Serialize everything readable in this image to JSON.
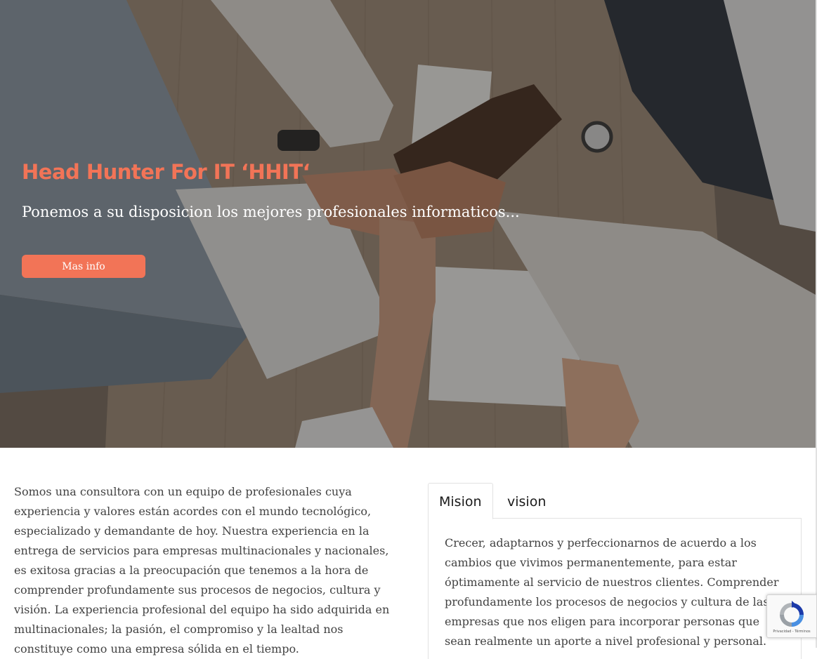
{
  "hero": {
    "title": "Head Hunter For IT ‘HHIT‘",
    "subtitle": "Ponemos a su disposicion los mejores profesionales informaticos...",
    "button_label": "Mas info"
  },
  "about": {
    "text": "Somos una consultora con un equipo de profesionales cuya experiencia y valores están acordes con el mundo tecnológico, especializado y demandante de hoy. Nuestra experiencia en la entrega de servicios para empresas multinacionales y nacionales, es exitosa gracias a la preocupación que tenemos a la hora de comprender profundamente sus procesos de negocios, cultura y visión. La experiencia profesional del equipo ha sido adquirida en multinacionales; la pasión, el compromiso y la lealtad nos constituye como una empresa sólida en el tiempo."
  },
  "tabs": {
    "items": [
      {
        "label": "Mision",
        "active": true
      },
      {
        "label": "vision",
        "active": false
      }
    ],
    "panel_text": "Crecer, adaptarnos y perfeccionarnos de acuerdo a los cambios que vivimos permanentemente, para estar óptimamente al servicio de nuestros clientes. Comprender profundamente los procesos de negocios y cultura de las empresas que nos eligen para incorporar personas que sean realmente un aporte a nivel profesional y personal."
  },
  "recaptcha": {
    "footer": "Privacidad - Términos"
  },
  "colors": {
    "accent": "#f27457",
    "body_text": "#424242",
    "border": "#e2e2e2"
  },
  "icons": {
    "recaptcha": "recaptcha-icon"
  }
}
